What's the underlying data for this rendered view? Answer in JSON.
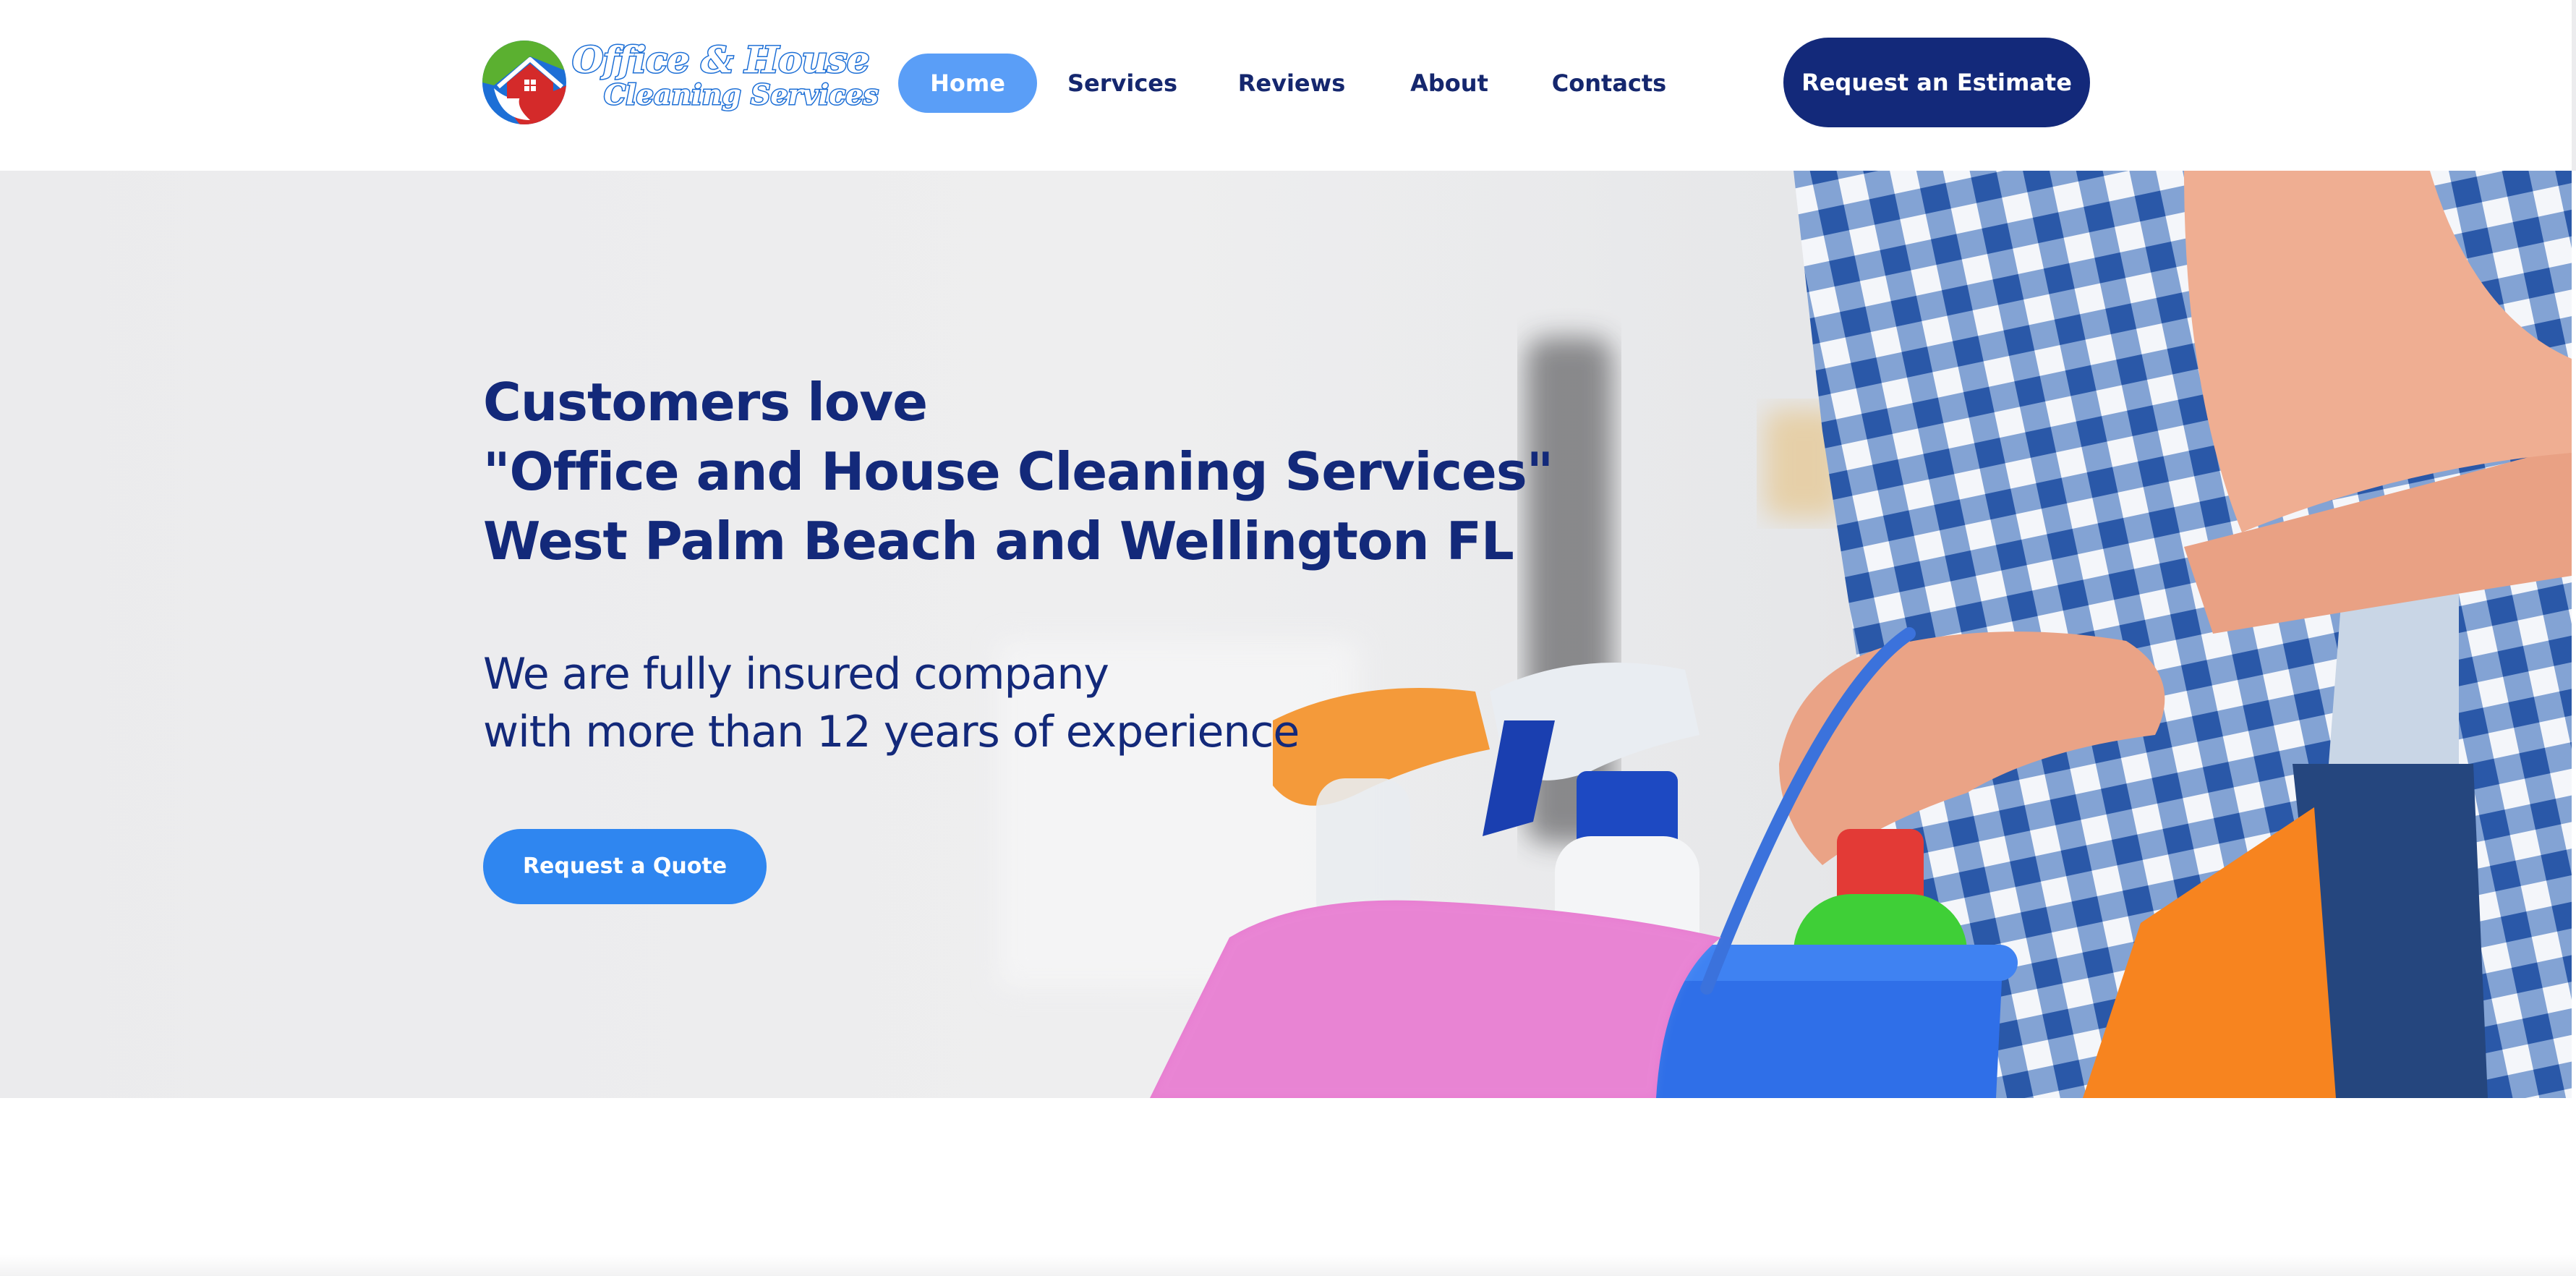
{
  "header": {
    "logo": {
      "line1": "Office & House",
      "line2": "Cleaning Services"
    },
    "nav": [
      {
        "label": "Home",
        "active": true
      },
      {
        "label": "Services",
        "active": false
      },
      {
        "label": "Reviews",
        "active": false
      },
      {
        "label": "About",
        "active": false
      },
      {
        "label": "Contacts",
        "active": false
      }
    ],
    "cta_label": "Request an Estimate"
  },
  "hero": {
    "headline": [
      "Customers love",
      "\"Office and House Cleaning Services\"",
      "West Palm Beach and Wellington FL"
    ],
    "subtext": [
      "We are fully insured company",
      "with more than 12 years of experience"
    ],
    "button_label": "Request a Quote"
  },
  "colors": {
    "navy": "#13297a",
    "nav_active": "#5a9ef7",
    "quote_button": "#2f86f0",
    "logo_green": "#5bb030",
    "logo_red": "#d42a2a",
    "logo_blue": "#1d6fd6"
  },
  "icons": [
    "house-logo-icon"
  ]
}
